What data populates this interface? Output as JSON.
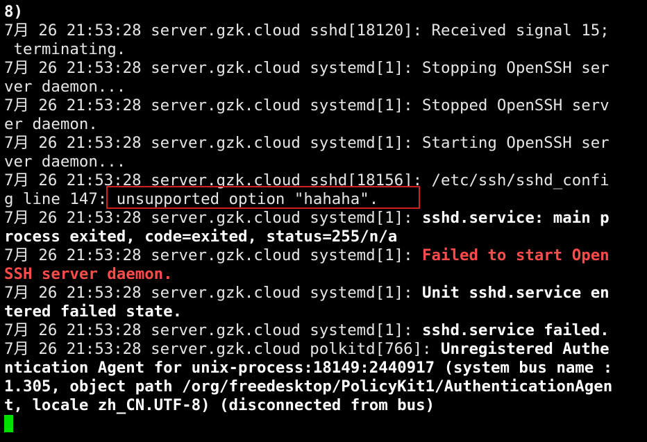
{
  "terminal": {
    "lines": [
      [
        {
          "t": "8)",
          "s": "b"
        }
      ],
      [
        {
          "t": "7月 26 21:53:28 server.gzk.cloud sshd[18120]: Received signal 15;",
          "s": "n"
        }
      ],
      [
        {
          "t": " terminating.",
          "s": "n"
        }
      ],
      [
        {
          "t": "7月 26 21:53:28 server.gzk.cloud systemd[1]: Stopping OpenSSH ser",
          "s": "n"
        }
      ],
      [
        {
          "t": "ver daemon...",
          "s": "n"
        }
      ],
      [
        {
          "t": "7月 26 21:53:28 server.gzk.cloud systemd[1]: Stopped OpenSSH serv",
          "s": "n"
        }
      ],
      [
        {
          "t": "er daemon.",
          "s": "n"
        }
      ],
      [
        {
          "t": "7月 26 21:53:28 server.gzk.cloud systemd[1]: Starting OpenSSH ser",
          "s": "n"
        }
      ],
      [
        {
          "t": "ver daemon...",
          "s": "n"
        }
      ],
      [
        {
          "t": "7月 26 21:53:28 server.gzk.cloud sshd[18156]: /etc/ssh/sshd_confi",
          "s": "n"
        }
      ],
      [
        {
          "t": "g line 147: unsupported option \"hahaha\".",
          "s": "n"
        }
      ],
      [
        {
          "t": "7月 26 21:53:28 server.gzk.cloud systemd[1]: ",
          "s": "n"
        },
        {
          "t": "sshd.service: main p",
          "s": "b"
        }
      ],
      [
        {
          "t": "rocess exited, code=exited, status=255/n/a",
          "s": "b"
        }
      ],
      [
        {
          "t": "7月 26 21:53:28 server.gzk.cloud systemd[1]: ",
          "s": "n"
        },
        {
          "t": "Failed to start Open",
          "s": "r"
        }
      ],
      [
        {
          "t": "SSH server daemon.",
          "s": "r"
        }
      ],
      [
        {
          "t": "7月 26 21:53:28 server.gzk.cloud systemd[1]: ",
          "s": "n"
        },
        {
          "t": "Unit sshd.service en",
          "s": "b"
        }
      ],
      [
        {
          "t": "tered failed state.",
          "s": "b"
        }
      ],
      [
        {
          "t": "7月 26 21:53:28 server.gzk.cloud systemd[1]: ",
          "s": "n"
        },
        {
          "t": "sshd.service failed.",
          "s": "b"
        }
      ],
      [
        {
          "t": "7月 26 21:53:28 server.gzk.cloud polkitd[766]: ",
          "s": "n"
        },
        {
          "t": "Unregistered Authe",
          "s": "b"
        }
      ],
      [
        {
          "t": "ntication Agent for unix-process:18149:2440917 (system bus name :",
          "s": "b"
        }
      ],
      [
        {
          "t": "1.305, object path /org/freedesktop/PolicyKit1/AuthenticationAgen",
          "s": "b"
        }
      ],
      [
        {
          "t": "t, locale zh_CN.UTF-8) (disconnected from bus)",
          "s": "b"
        }
      ]
    ]
  },
  "colors": {
    "background": "#000000",
    "text": "#e6e6e6",
    "bold_text": "#ffffff",
    "error_text": "#ff4b4b",
    "highlight_border": "#d02020",
    "cursor": "#00e000"
  }
}
